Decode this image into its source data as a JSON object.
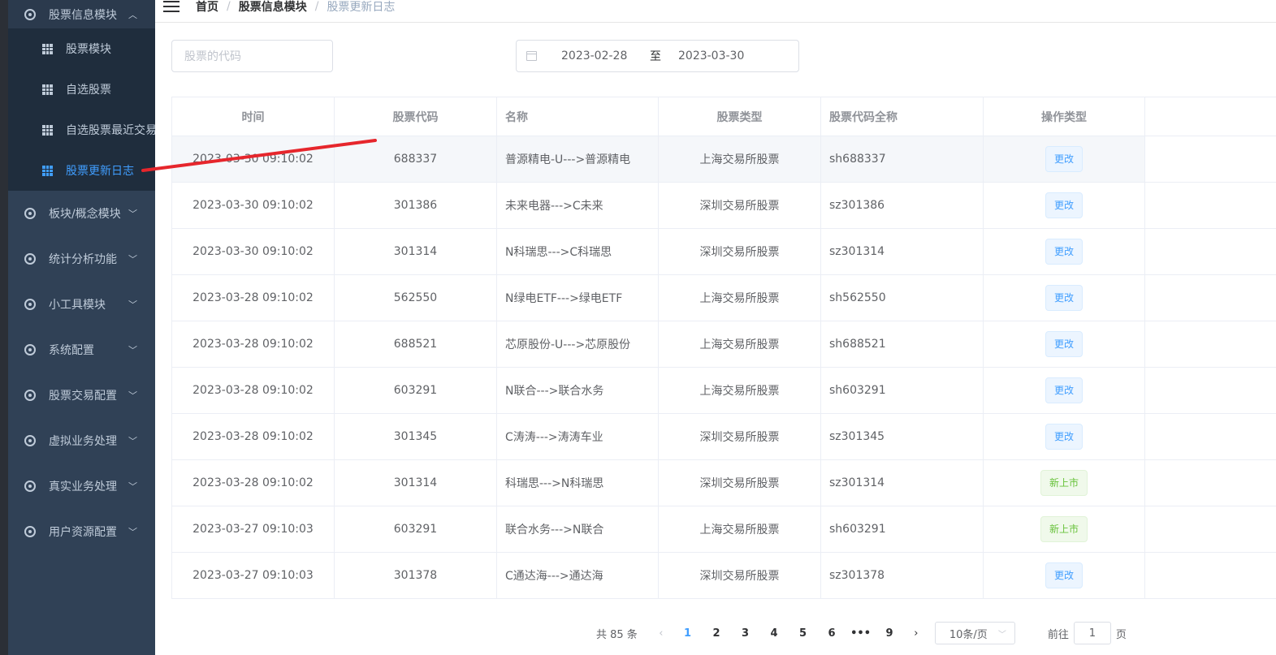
{
  "sidebar": {
    "group_title": "股票信息模块",
    "sub_items": [
      {
        "label": "股票模块"
      },
      {
        "label": "自选股票"
      },
      {
        "label": "自选股票最近交易"
      },
      {
        "label": "股票更新日志"
      }
    ],
    "menu_items": [
      {
        "label": "板块/概念模块"
      },
      {
        "label": "统计分析功能"
      },
      {
        "label": "小工具模块"
      },
      {
        "label": "系统配置"
      },
      {
        "label": "股票交易配置"
      },
      {
        "label": "虚拟业务处理"
      },
      {
        "label": "真实业务处理"
      },
      {
        "label": "用户资源配置"
      }
    ],
    "expand_icon": "chevron-up-icon",
    "collapse_icon": "chevron-down-icon"
  },
  "breadcrumb": {
    "home": "首页",
    "module": "股票信息模块",
    "current": "股票更新日志",
    "sep": "/"
  },
  "filters": {
    "search_placeholder": "股票的代码",
    "start_date": "2023-02-28",
    "range_separator": "至",
    "end_date": "2023-03-30"
  },
  "table": {
    "headers": [
      "时间",
      "股票代码",
      "名称",
      "股票类型",
      "股票代码全称",
      "操作类型"
    ],
    "rows": [
      {
        "time": "2023-03-30 09:10:02",
        "code": "688337",
        "name": "普源精电-U--->普源精电",
        "type": "上海交易所股票",
        "full": "sh688337",
        "op": "更改",
        "op_kind": "primary"
      },
      {
        "time": "2023-03-30 09:10:02",
        "code": "301386",
        "name": "未来电器--->C未来",
        "type": "深圳交易所股票",
        "full": "sz301386",
        "op": "更改",
        "op_kind": "primary"
      },
      {
        "time": "2023-03-30 09:10:02",
        "code": "301314",
        "name": "N科瑞思--->C科瑞思",
        "type": "深圳交易所股票",
        "full": "sz301314",
        "op": "更改",
        "op_kind": "primary"
      },
      {
        "time": "2023-03-28 09:10:02",
        "code": "562550",
        "name": "N绿电ETF--->绿电ETF",
        "type": "上海交易所股票",
        "full": "sh562550",
        "op": "更改",
        "op_kind": "primary"
      },
      {
        "time": "2023-03-28 09:10:02",
        "code": "688521",
        "name": "芯原股份-U--->芯原股份",
        "type": "上海交易所股票",
        "full": "sh688521",
        "op": "更改",
        "op_kind": "primary"
      },
      {
        "time": "2023-03-28 09:10:02",
        "code": "603291",
        "name": "N联合--->联合水务",
        "type": "上海交易所股票",
        "full": "sh603291",
        "op": "更改",
        "op_kind": "primary"
      },
      {
        "time": "2023-03-28 09:10:02",
        "code": "301345",
        "name": "C涛涛--->涛涛车业",
        "type": "深圳交易所股票",
        "full": "sz301345",
        "op": "更改",
        "op_kind": "primary"
      },
      {
        "time": "2023-03-28 09:10:02",
        "code": "301314",
        "name": "科瑞思--->N科瑞思",
        "type": "深圳交易所股票",
        "full": "sz301314",
        "op": "新上市",
        "op_kind": "success"
      },
      {
        "time": "2023-03-27 09:10:03",
        "code": "603291",
        "name": "联合水务--->N联合",
        "type": "上海交易所股票",
        "full": "sh603291",
        "op": "新上市",
        "op_kind": "success"
      },
      {
        "time": "2023-03-27 09:10:03",
        "code": "301378",
        "name": "C通达海--->通达海",
        "type": "深圳交易所股票",
        "full": "sz301378",
        "op": "更改",
        "op_kind": "primary"
      }
    ]
  },
  "pagination": {
    "total": "共 85 条",
    "pages": [
      "1",
      "2",
      "3",
      "4",
      "5",
      "6",
      "•••",
      "9"
    ],
    "current": "1",
    "page_size": "10条/页",
    "goto_prefix": "前往",
    "goto_value": "1",
    "goto_suffix": "页"
  },
  "colors": {
    "accent": "#409eff",
    "sidebar_bg": "#304156",
    "success": "#67c23a",
    "annotation": "#e6262c"
  }
}
